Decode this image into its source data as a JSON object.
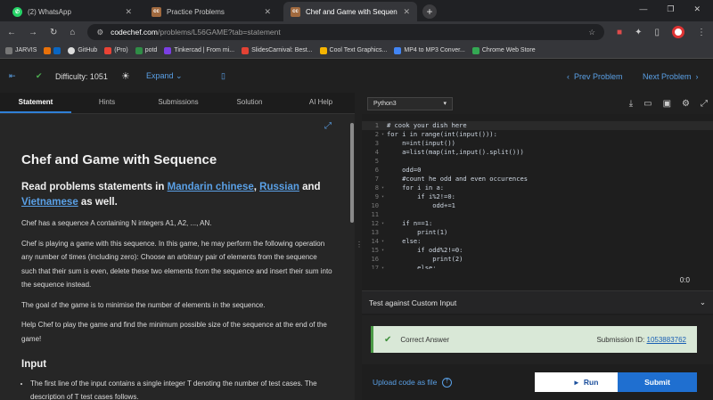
{
  "browser": {
    "tabs": [
      {
        "title": "(2) WhatsApp",
        "icon": "whatsapp-icon",
        "active": false
      },
      {
        "title": "Practice Problems",
        "icon": "codechef-icon",
        "active": false
      },
      {
        "title": "Chef and Game with Sequence",
        "icon": "codechef-icon",
        "active": true
      }
    ],
    "new_tab": "+",
    "url_domain": "codechef.com",
    "url_path": "/problems/L56GAME?tab=statement",
    "bookmarks": [
      "JARVIS",
      "GitHub",
      "(Pro)",
      "potd",
      "Tinkercad | From mi...",
      "SlidesCarnival: Best...",
      "Cool Text Graphics...",
      "MP4 to MP3 Conver...",
      "Chrome Web Store"
    ]
  },
  "toolbar": {
    "difficulty": "Difficulty: 1051",
    "expand": "Expand",
    "prev": "Prev Problem",
    "next": "Next Problem"
  },
  "nav_tabs": [
    "Statement",
    "Hints",
    "Submissions",
    "Solution",
    "AI Help"
  ],
  "problem": {
    "title": "Chef and Game with Sequence",
    "read_intro": "Read problems statements in ",
    "lang1": "Mandarin chinese",
    "sep1": ", ",
    "lang2": "Russian",
    "sep2": " and ",
    "lang3": "Vietnamese",
    "read_end": " as well.",
    "p1": "Chef has a sequence A containing N integers A1, A2, ..., AN.",
    "p2": "Chef is playing a game with this sequence. In this game, he may perform the following operation any number of times (including zero): Choose an arbitrary pair of elements from the sequence such that their sum is even, delete these two elements from the sequence and insert their sum into the sequence instead.",
    "p3": "The goal of the game is to minimise the number of elements in the sequence.",
    "p4": "Help Chef to play the game and find the minimum possible size of the sequence at the end of the game!",
    "input_heading": "Input",
    "input_item": "The first line of the input contains a single integer T denoting the number of test cases. The description of T test cases follows."
  },
  "editor": {
    "language": "Python3",
    "lines": [
      "# cook your dish here",
      "for i in range(int(input())):",
      "    n=int(input())",
      "    a=list(map(int,input().split()))",
      "",
      "    odd=0",
      "    #count he odd and even occurences",
      "    for i in a:",
      "        if i%2!=0:",
      "            odd+=1",
      "",
      "    if n==1:",
      "        print(1)",
      "    else:",
      "        if odd%2!=0:",
      "            print(2)",
      "        else:"
    ],
    "cursor": "0:0"
  },
  "custom_input": "Test against Custom Input",
  "result": {
    "status": "Correct Answer",
    "submission_label": "Submission ID:",
    "submission_id": "1053883762"
  },
  "actions": {
    "upload": "Upload code as file",
    "run": "Run",
    "submit": "Submit"
  }
}
